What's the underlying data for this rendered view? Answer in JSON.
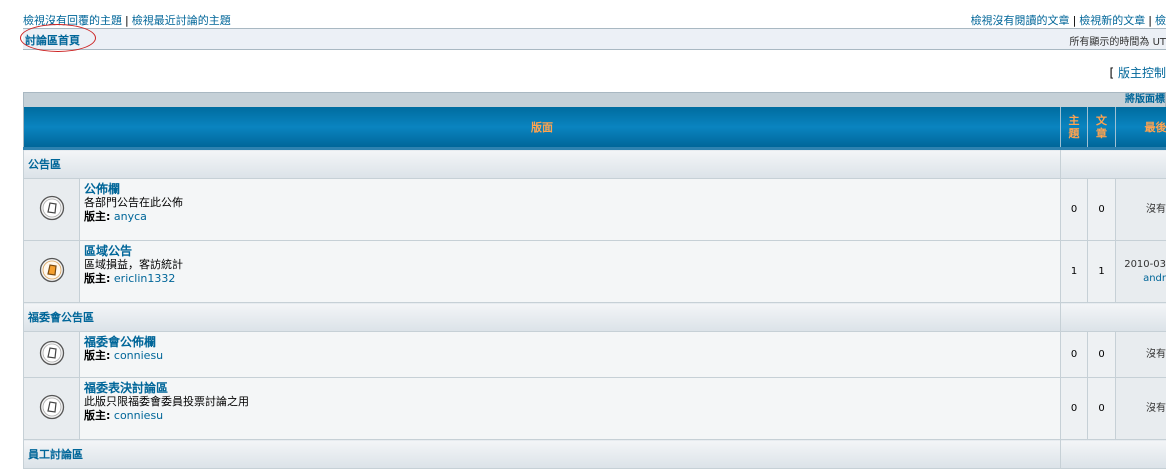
{
  "top_links": {
    "unanswered": "檢視沒有回覆的主題",
    "active": "檢視最近討論的主題",
    "unread": "檢視沒有閱讀的文章",
    "new_posts": "檢視新的文章",
    "more": "檢"
  },
  "nav": {
    "home": "討論區首頁",
    "timezone": "所有顯示的時間為 UT"
  },
  "moderator_cp": "版主控制",
  "table": {
    "strip_label": "將版面標",
    "headers": {
      "forum": "版面",
      "topics": "主題",
      "posts": "文章",
      "last_post": "最後"
    },
    "categories": [
      {
        "name": "公告區",
        "forums": [
          {
            "name": "公佈欄",
            "description": "各部門公告在此公佈",
            "moderator_label": "版主:",
            "moderator": "anyca",
            "topics": "0",
            "posts": "0",
            "last_post": "沒有",
            "last_post_user": "",
            "unread": false
          },
          {
            "name": "區域公告",
            "description": "區域損益，客訪統計",
            "moderator_label": "版主:",
            "moderator": "ericlin1332",
            "topics": "1",
            "posts": "1",
            "last_post": "2010-03",
            "last_post_user": "andr",
            "unread": true
          }
        ]
      },
      {
        "name": "福委會公告區",
        "forums": [
          {
            "name": "福委會公佈欄",
            "description": "",
            "moderator_label": "版主:",
            "moderator": "conniesu",
            "topics": "0",
            "posts": "0",
            "last_post": "沒有",
            "last_post_user": "",
            "unread": false
          },
          {
            "name": "福委表決討論區",
            "description": "此版只限福委會委員投票討論之用",
            "moderator_label": "版主:",
            "moderator": "conniesu",
            "topics": "0",
            "posts": "0",
            "last_post": "沒有",
            "last_post_user": "",
            "unread": false
          }
        ]
      },
      {
        "name": "員工討論區",
        "forums": []
      }
    ]
  },
  "colors": {
    "link": "#006699",
    "header_text": "#ffa34f",
    "header_bg": "#006699",
    "annotation_ellipse": "#cc2222"
  }
}
